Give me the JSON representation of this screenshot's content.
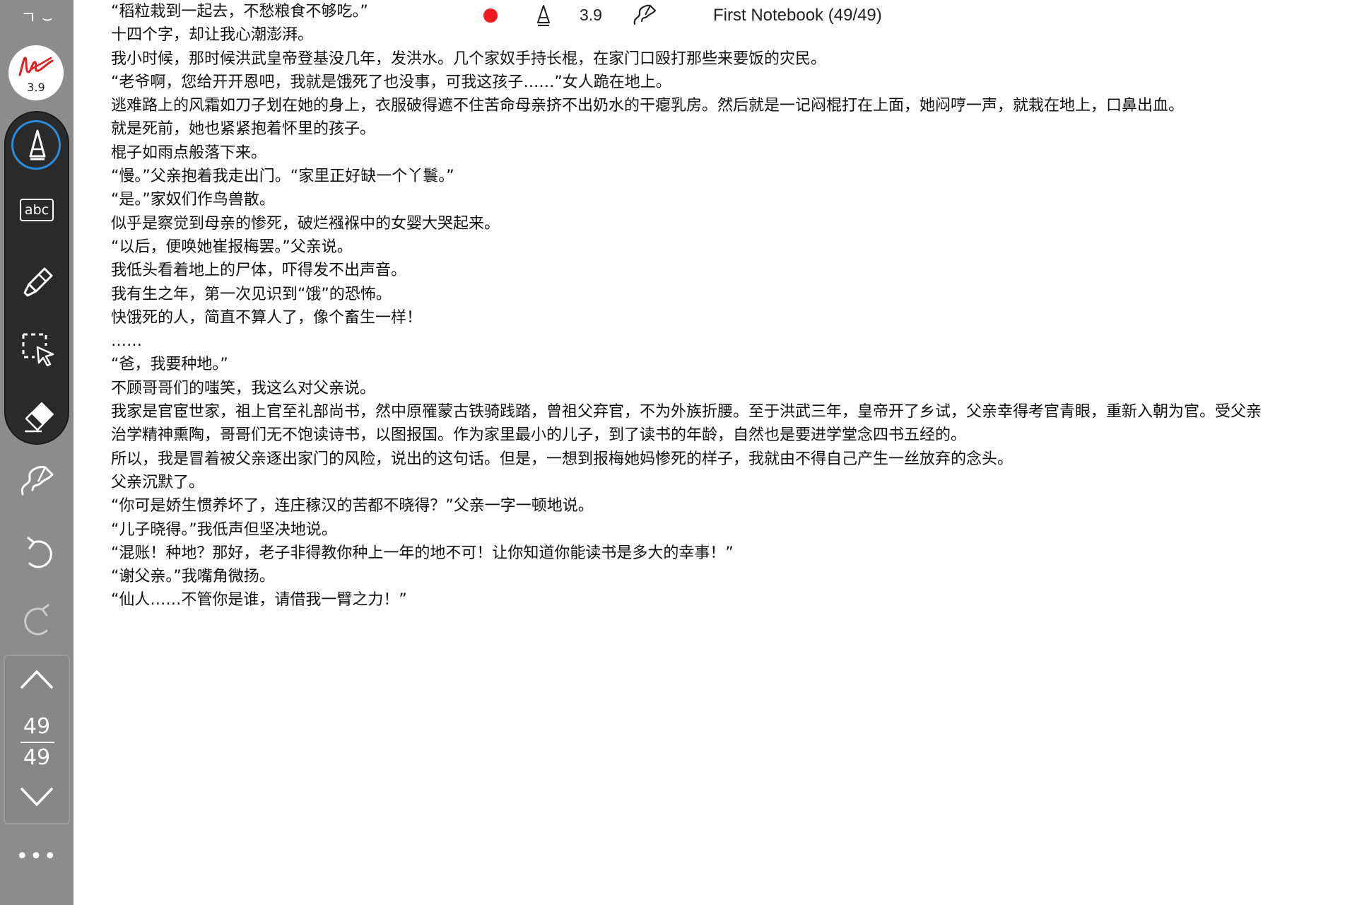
{
  "sidebar": {
    "collapse_glyph": "ㄱ ⌣",
    "pen_preview": {
      "size": "3.9",
      "ink_color": "#e02020"
    },
    "tools": [
      {
        "id": "pen",
        "icon": "fountain-pen-icon",
        "selected": true
      },
      {
        "id": "text",
        "icon": "text-box-icon",
        "label": "abc"
      },
      {
        "id": "highlighter",
        "icon": "highlighter-icon"
      },
      {
        "id": "lasso",
        "icon": "lasso-select-icon"
      },
      {
        "id": "eraser",
        "icon": "eraser-icon"
      }
    ],
    "stroke_icon": "stroke-style-icon",
    "undo_icon": "undo-icon",
    "redo_icon": "redo-icon",
    "page_nav": {
      "current": "49",
      "total": "49"
    },
    "more_label": "•••"
  },
  "status_bar": {
    "recording_color": "#ee1c1c",
    "pen_icon": "fountain-pen-icon",
    "pen_size": "3.9",
    "stroke_icon": "stroke-style-icon",
    "notebook_title": "First Notebook (49/49)"
  },
  "document": {
    "lines": [
      "“稻粒栽到一起去，不愁粮食不够吃。”",
      "十四个字，却让我心潮澎湃。",
      "我小时候，那时候洪武皇帝登基没几年，发洪水。几个家奴手持长棍，在家门口殴打那些来要饭的灾民。",
      "“老爷啊，您给开开恩吧，我就是饿死了也没事，可我这孩子……”女人跪在地上。",
      "逃难路上的风霜如刀子划在她的身上，衣服破得遮不住苦命母亲挤不出奶水的干瘪乳房。然后就是一记闷棍打在上面，她闷哼一声，就栽在地上，口鼻出血。",
      "就是死前，她也紧紧抱着怀里的孩子。",
      "棍子如雨点般落下来。",
      "“慢。”父亲抱着我走出门。“家里正好缺一个丫鬟。”",
      "“是。”家奴们作鸟兽散。",
      "似乎是察觉到母亲的惨死，破烂襁褓中的女婴大哭起来。",
      "“以后，便唤她崔报梅罢。”父亲说。",
      "我低头看着地上的尸体，吓得发不出声音。",
      "我有生之年，第一次见识到“饿”的恐怖。",
      "快饿死的人，简直不算人了，像个畜生一样！",
      "……",
      "“爸，我要种地。”",
      "不顾哥哥们的嗤笑，我这么对父亲说。",
      "我家是官宦世家，祖上官至礼部尚书，然中原罹蒙古铁骑践踏，曾祖父弃官，不为外族折腰。至于洪武三年，皇帝开了乡试，父亲幸得考官青眼，重新入朝为官。受父亲治学精神熏陶，哥哥们无不饱读诗书，以图报国。作为家里最小的儿子，到了读书的年龄，自然也是要进学堂念四书五经的。",
      "所以，我是冒着被父亲逐出家门的风险，说出的这句话。但是，一想到报梅她妈惨死的样子，我就由不得自己产生一丝放弃的念头。",
      "父亲沉默了。",
      "“你可是娇生惯养坏了，连庄稼汉的苦都不晓得？”父亲一字一顿地说。",
      "“儿子晓得。”我低声但坚决地说。",
      "“混账！种地？那好，老子非得教你种上一年的地不可！让你知道你能读书是多大的幸事！”",
      "“谢父亲。”我嘴角微扬。",
      "“仙人……不管你是谁，请借我一臂之力！”"
    ]
  },
  "colors": {
    "sidebar_bg": "#8c8c8c",
    "toolgroup_bg": "#2a2a2a",
    "selection_ring": "#2b8cdb",
    "text": "#111111"
  }
}
